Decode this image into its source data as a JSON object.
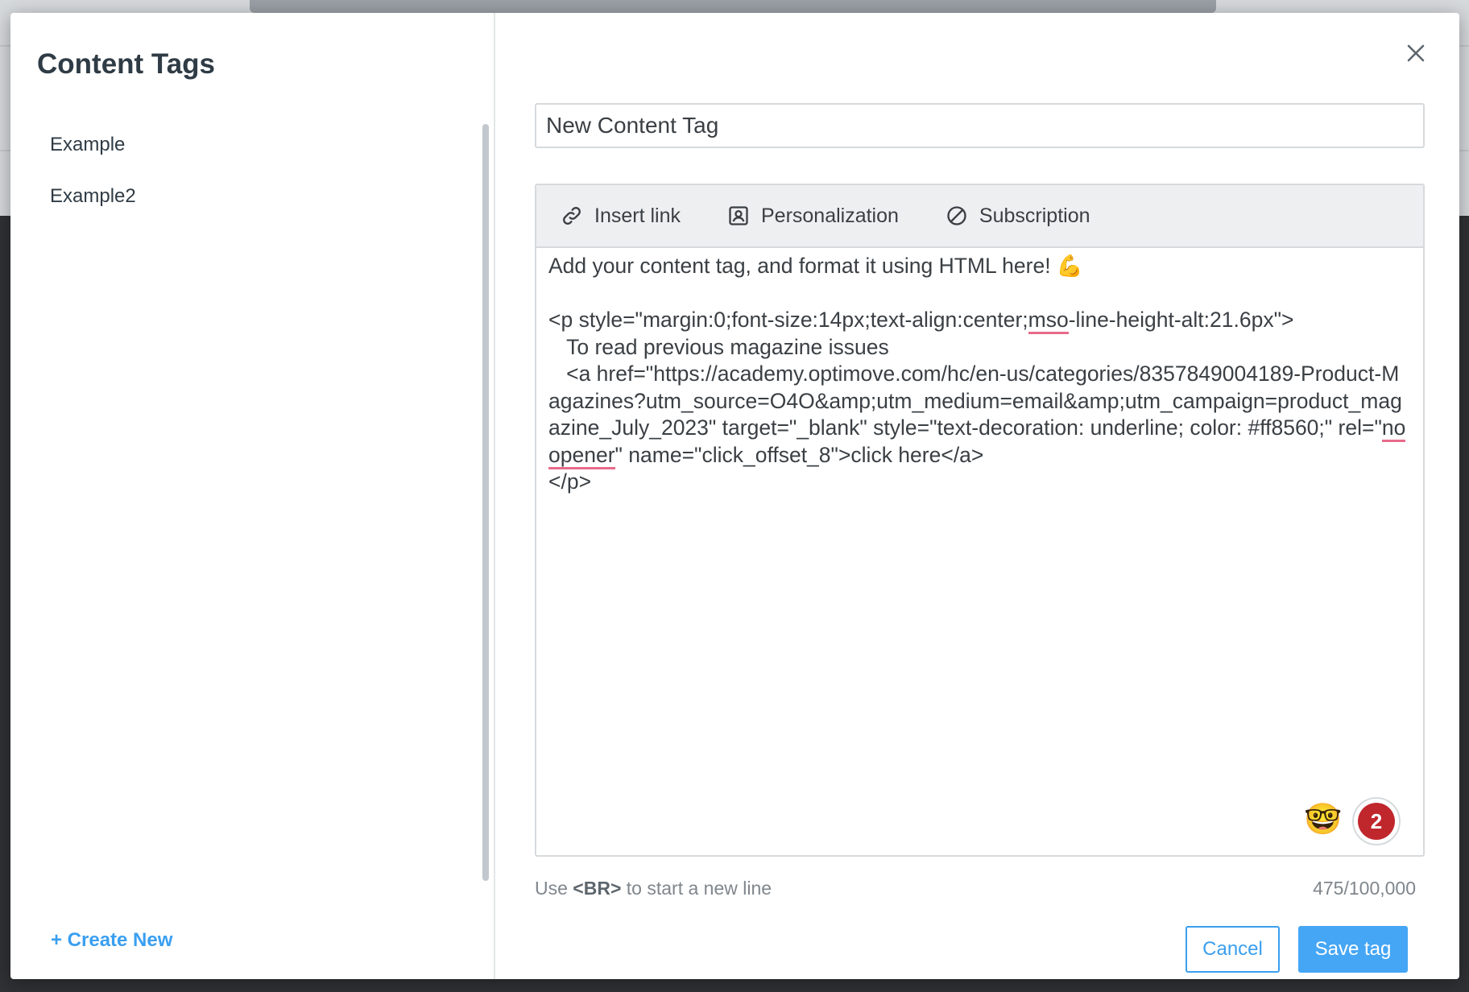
{
  "sidebar": {
    "title": "Content Tags",
    "items": [
      {
        "label": "Example"
      },
      {
        "label": "Example2"
      }
    ],
    "create_new_label": "+ Create New"
  },
  "editor": {
    "tag_name_value": "New Content Tag",
    "toolbar": {
      "insert_link": "Insert link",
      "personalization": "Personalization",
      "subscription": "Subscription"
    },
    "content": {
      "line1": "Add your content tag, and format it using HTML here! 💪",
      "line3a": "<p style=\"margin:0;font-size:14px;text-align:center;",
      "line3_squiggle": "mso",
      "line3b": "-line-height-alt:21.6px\">",
      "line4": "   To read previous magazine issues",
      "line5": "   <a href=\"https://academy.optimove.com/hc/en-us/categories/8357849004189-Product-Magazines?utm_source=O4O&amp;utm_medium=email&amp;utm_campaign=product_magazine_July_2023\" target=\"_blank\" style=\"text-decoration: underline; color: #ff8560;\" rel=\"",
      "line5_squiggle": "noopener",
      "line5b": "\" name=\"click_offset_8\">click here</a>",
      "line6": "</p>"
    },
    "emoji": "🤓",
    "badge_count": "2"
  },
  "footer": {
    "hint_prefix": "Use ",
    "hint_code": "<BR>",
    "hint_suffix": " to start a new line",
    "counter": "475/100,000",
    "cancel_label": "Cancel",
    "save_label": "Save tag"
  },
  "colors": {
    "accent": "#3a9ff0",
    "save_button": "#45a6f5",
    "badge": "#c0272d",
    "spellcheck": "#e86a8a"
  },
  "icons": {
    "close": "close-icon",
    "link": "link-icon",
    "personalization": "person-card-icon",
    "subscription": "prohibited-icon"
  }
}
